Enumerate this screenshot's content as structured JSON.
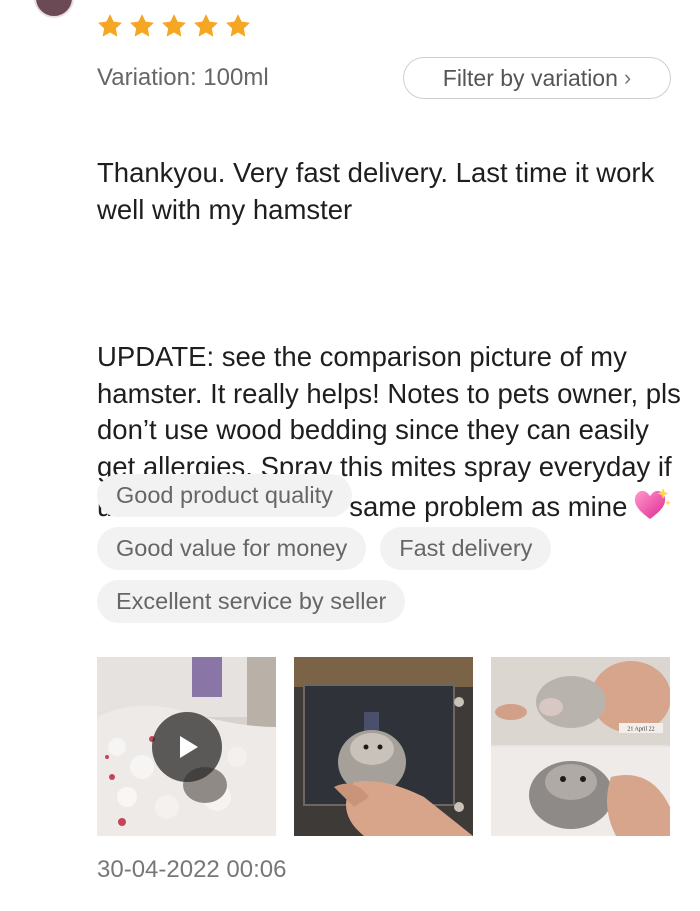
{
  "rating": {
    "stars": 5,
    "max": 5,
    "star_color": "#f5a623"
  },
  "variation": {
    "text": "Variation: 100ml"
  },
  "filter_button": {
    "label": "Filter by variation",
    "chevron": "›"
  },
  "review": {
    "paragraph_1": "Thankyou. Very fast delivery. Last time it work well with my hamster",
    "paragraph_2": "UPDATE: see the comparison picture of my hamster. It really helps! Notes to pets owner, pls don’t use wood bedding since they can easily get allergies. Spray this mites spray everyday if ur hamster have the same problem as mine",
    "emoji": "sparkling-heart-icon"
  },
  "tags": [
    [
      "Good product quality"
    ],
    [
      "Good value for money",
      "Fast delivery"
    ],
    [
      "Excellent service by seller"
    ]
  ],
  "media": [
    {
      "type": "video",
      "icon": "play-icon",
      "subject": "hamster video thumbnail"
    },
    {
      "type": "image",
      "subject": "hamster held in hand"
    },
    {
      "type": "image",
      "subject": "hamster comparison photo",
      "caption": "21 April 22"
    }
  ],
  "timestamp": "30-04-2022 00:06"
}
